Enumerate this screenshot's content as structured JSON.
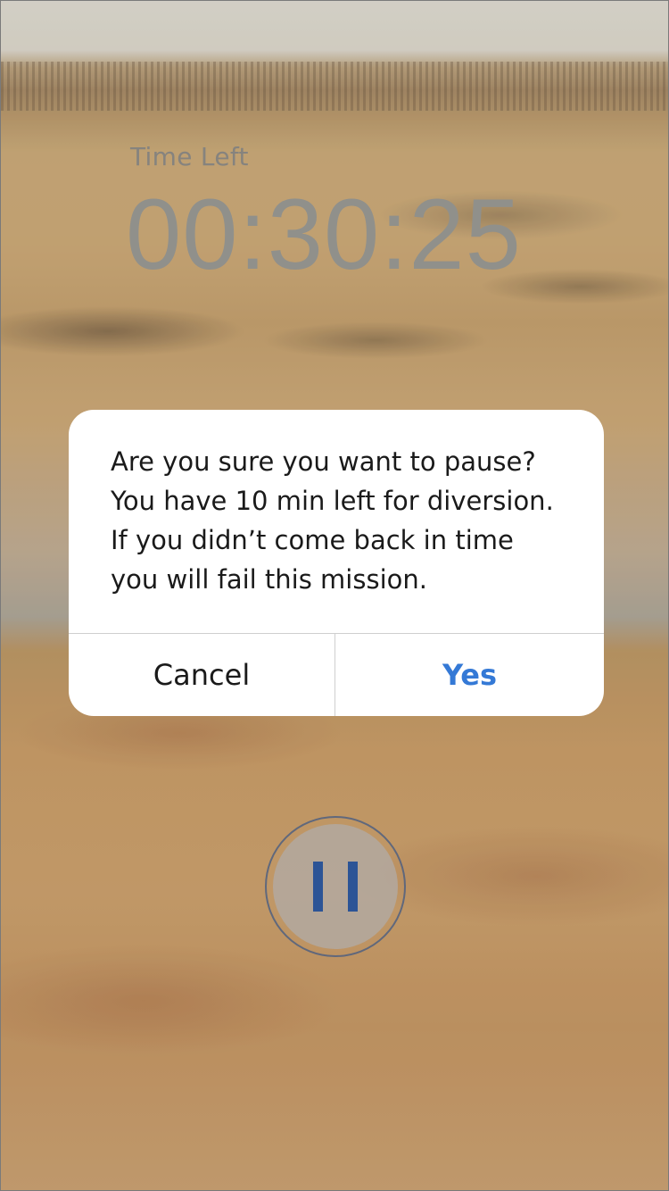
{
  "timer": {
    "label": "Time Left",
    "value": "00:30:25"
  },
  "alert": {
    "message": "Are you sure you want to pause?\nYou have 10 min left for diversion.\nIf you didn’t come back in time\nyou will fail this mission.",
    "cancel_label": "Cancel",
    "confirm_label": "Yes"
  },
  "pause_button": {
    "icon": "pause-icon"
  },
  "colors": {
    "accent": "#3479d6",
    "pause_icon": "#2f5aa0"
  }
}
